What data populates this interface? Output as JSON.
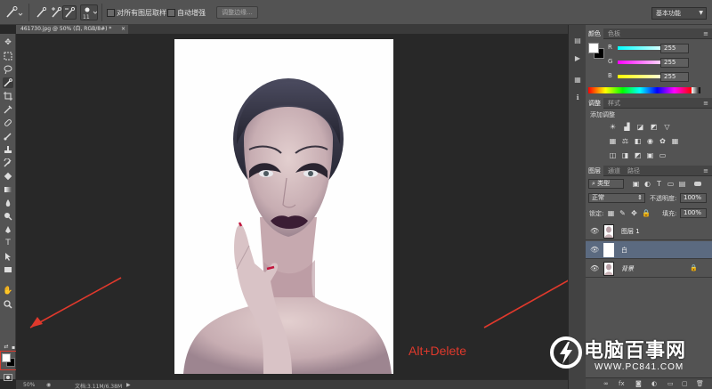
{
  "options_bar": {
    "brush_size": "11",
    "sample_all_layers_label": "对所有图层取样",
    "auto_enhance_label": "自动增强",
    "refine_edge_label": "调整边缘...",
    "workspace_label": "基本功能"
  },
  "document": {
    "tab_title": "461730.jpg @ 50% (白, RGB/8#) *",
    "tab_close": "×"
  },
  "status_bar": {
    "zoom": "50%",
    "doc_info": "文档:3.11M/6.38M"
  },
  "color_panel": {
    "tabs": [
      "颜色",
      "色板"
    ],
    "channels": [
      {
        "label": "R",
        "value": "255"
      },
      {
        "label": "G",
        "value": "255"
      },
      {
        "label": "B",
        "value": "255"
      }
    ]
  },
  "adjustments_panel": {
    "tabs": [
      "调整",
      "样式"
    ],
    "add_adjustment_label": "添加调整"
  },
  "layers_panel": {
    "tabs": [
      "图层",
      "通道",
      "路径"
    ],
    "filter_kind": "类型",
    "blend_mode": "正常",
    "opacity_label": "不透明度:",
    "opacity_value": "100%",
    "lock_label": "锁定:",
    "fill_label": "填充:",
    "fill_value": "100%",
    "layers": [
      {
        "name": "图层 1",
        "selected": false,
        "locked": false
      },
      {
        "name": "白",
        "selected": true,
        "locked": false
      },
      {
        "name": "背景",
        "selected": false,
        "locked": true
      }
    ]
  },
  "annotation": {
    "text": "Alt+Delete",
    "color": "#e0392c"
  },
  "watermark": {
    "title": "电脑百事网",
    "url": "WWW.PC841.COM"
  },
  "colors": {
    "accent": "#e0392c",
    "selected_layer": "#5b6a80",
    "panel_bg": "#535353",
    "canvas_bg": "#282828"
  }
}
